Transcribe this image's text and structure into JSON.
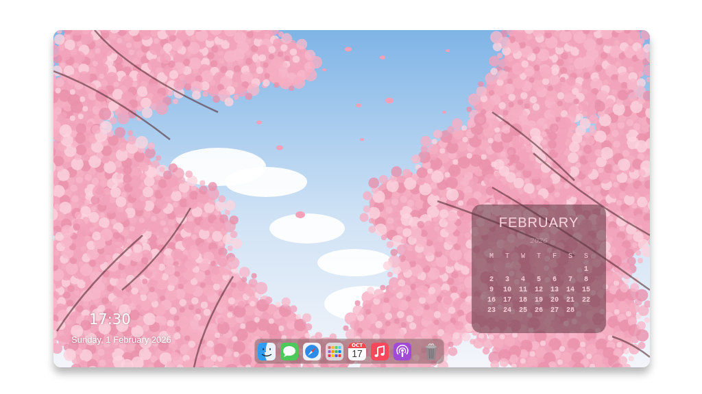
{
  "desktop": {
    "clock": {
      "time": "17:30",
      "date": "Sunday, 1 February 2026"
    },
    "calendar_widget": {
      "month": "FEBRUARY",
      "year": "2026",
      "weekdays": [
        "M",
        "T",
        "W",
        "T",
        "F",
        "S",
        "S"
      ],
      "weeks": [
        [
          "1"
        ],
        [
          "2",
          "3",
          "4",
          "5",
          "6",
          "7",
          "8"
        ],
        [
          "9",
          "10",
          "11",
          "12",
          "13",
          "14",
          "15"
        ],
        [
          "16",
          "17",
          "18",
          "19",
          "20",
          "21",
          "22"
        ],
        [
          "23",
          "24",
          "25",
          "26",
          "27",
          "28"
        ]
      ]
    },
    "dock": {
      "apps": [
        {
          "kind": "face"
        },
        {
          "kind": "chat"
        },
        {
          "kind": "compass"
        },
        {
          "kind": "grid"
        },
        {
          "kind": "calendar",
          "month": "OCT",
          "day": "17"
        },
        {
          "kind": "note"
        },
        {
          "kind": "podcast"
        },
        {
          "kind": "trash"
        }
      ]
    }
  }
}
